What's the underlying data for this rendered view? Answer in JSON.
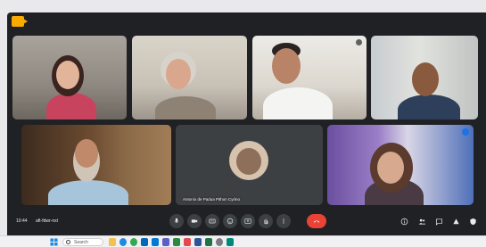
{
  "window": {
    "app": "Google Meet"
  },
  "participants": [
    {
      "id": "p1",
      "name": "",
      "muted": false,
      "active": false
    },
    {
      "id": "p2",
      "name": "",
      "muted": false,
      "active": false
    },
    {
      "id": "p3",
      "name": "",
      "muted": false,
      "active": false
    },
    {
      "id": "p4",
      "name": "",
      "muted": false,
      "active": false
    },
    {
      "id": "p5",
      "name": "",
      "muted": false,
      "active": false
    },
    {
      "id": "p6",
      "name": "Antonio de Padua Pithon Cyrino",
      "muted": true,
      "active": false
    },
    {
      "id": "p7",
      "name": "",
      "muted": false,
      "active": true
    }
  ],
  "toolbar": {
    "time": "10:44",
    "meeting_code": "aft-fdwr-nxt",
    "buttons": [
      "mic-icon",
      "camera-icon",
      "captions-icon",
      "emoji-icon",
      "present-icon",
      "raise-hand-icon",
      "more-icon",
      "end-call-icon"
    ],
    "right_icons": [
      "info-icon",
      "people-icon",
      "chat-icon",
      "activities-icon",
      "host-controls-icon"
    ]
  },
  "taskbar": {
    "search_label": "Search",
    "apps": [
      "file-explorer-icon",
      "edge-icon",
      "chrome-icon",
      "store-icon",
      "mail-icon",
      "teams-icon",
      "calendar-icon",
      "photos-icon",
      "word-icon",
      "excel-icon",
      "settings-icon",
      "meet-icon"
    ],
    "colors": {
      "accent": "#1a73e8",
      "end_call": "#ea4335",
      "meet_bg": "#202124"
    }
  }
}
